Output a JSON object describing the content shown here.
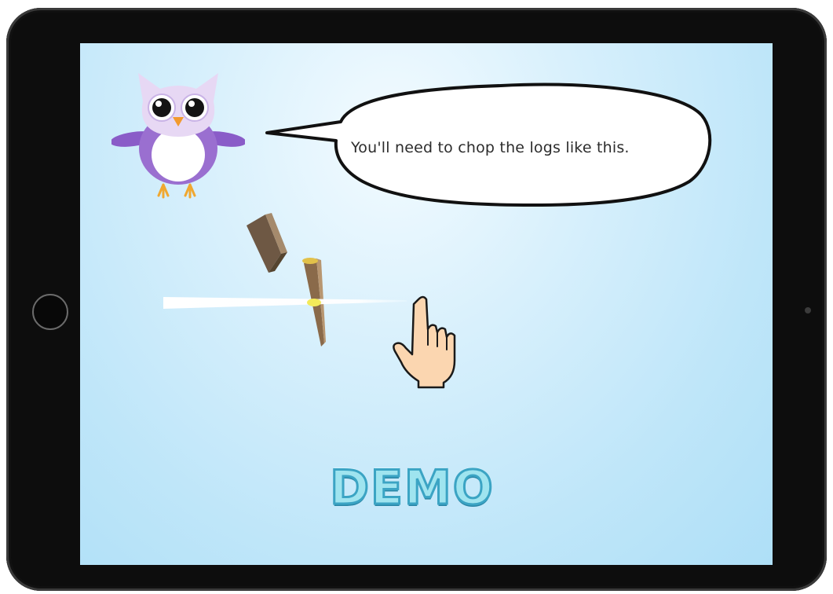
{
  "tutorial": {
    "speech_text": "You'll need to chop the logs like this.",
    "mode_label": "DEMO"
  },
  "icons": {
    "owl": "owl-mascot-icon",
    "hand": "pointing-hand-icon",
    "log": "wooden-log-icon"
  },
  "colors": {
    "sky": "#bfe6f9",
    "owl_purple": "#9a6fd0",
    "log_wood": "#8a6a4a",
    "demo_text": "#9fe4ef",
    "demo_outline": "#3ba4c4"
  }
}
